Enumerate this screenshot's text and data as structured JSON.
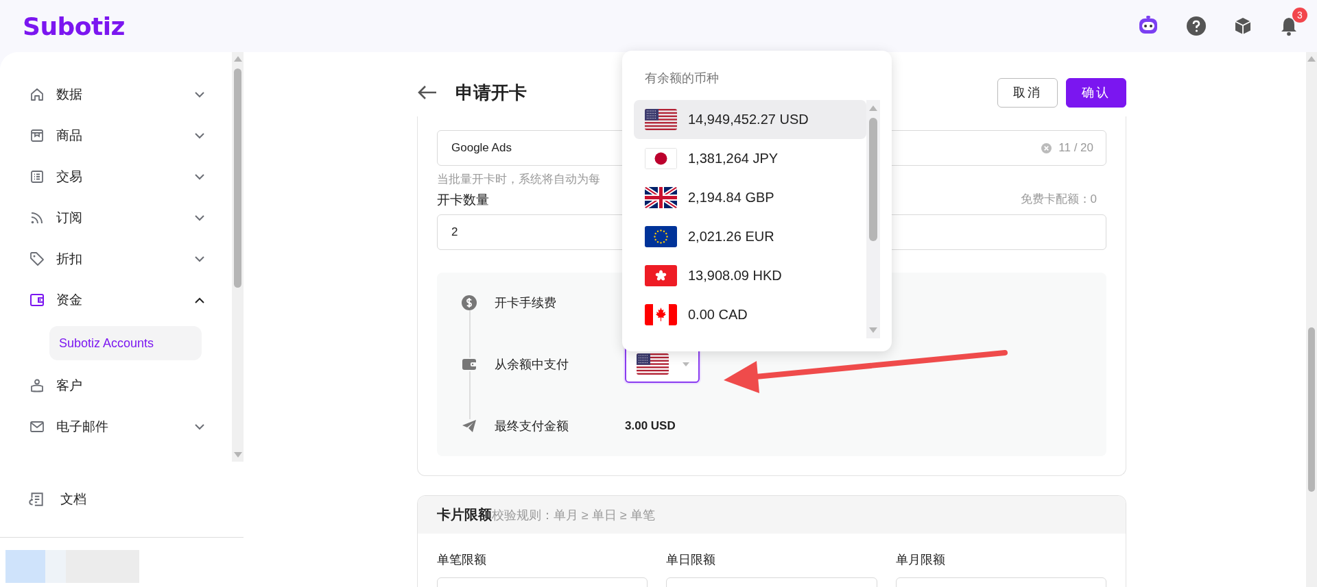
{
  "header": {
    "logo": "Subotiz",
    "notification_count": "3"
  },
  "sidebar": {
    "items": [
      {
        "label": "数据",
        "kind": "group",
        "expanded": false
      },
      {
        "label": "商品",
        "kind": "group",
        "expanded": false
      },
      {
        "label": "交易",
        "kind": "group",
        "expanded": false
      },
      {
        "label": "订阅",
        "kind": "group",
        "expanded": false
      },
      {
        "label": "折扣",
        "kind": "group",
        "expanded": false
      },
      {
        "label": "资金",
        "kind": "group",
        "expanded": true,
        "children": [
          {
            "label": "Subotiz Accounts",
            "selected": true
          }
        ]
      },
      {
        "label": "客户",
        "kind": "link",
        "expanded": false
      },
      {
        "label": "电子邮件",
        "kind": "group",
        "expanded": false
      }
    ],
    "docs": {
      "label": "文档"
    }
  },
  "page": {
    "title": "申请开卡",
    "buttons": [
      {
        "label": "取消",
        "kind": "secondary"
      },
      {
        "label": "确认",
        "kind": "primary"
      }
    ]
  },
  "form": {
    "name_field": {
      "value": "Google Ads",
      "counter": "11 / 20"
    },
    "helper": "当批量开卡时，系统将自动为每",
    "quantity": {
      "label": "开卡数量",
      "quota": "免费卡配额：0",
      "value": "2"
    },
    "payment_steps": [
      {
        "label": "开卡手续费",
        "kind": "fee"
      },
      {
        "label": "从余额中支付",
        "kind": "currency-select"
      },
      {
        "label": "最终支付金额",
        "kind": "amount",
        "value": "3.00 USD"
      }
    ]
  },
  "currency_dropdown": {
    "title": "有余额的币种",
    "options": [
      {
        "amount": "14,949,452.27 USD",
        "selected": true
      },
      {
        "amount": "1,381,264 JPY",
        "selected": false
      },
      {
        "amount": "2,194.84 GBP",
        "selected": false
      },
      {
        "amount": "2,021.26 EUR",
        "selected": false
      },
      {
        "amount": "13,908.09 HKD",
        "selected": false
      },
      {
        "amount": "0.00 CAD",
        "selected": false
      }
    ]
  },
  "limits": {
    "title": "卡片限额",
    "rule": "校验规则：单月 ≥ 单日 ≥ 单笔",
    "fields": [
      "单笔限额",
      "单日限额",
      "单月限额"
    ]
  }
}
